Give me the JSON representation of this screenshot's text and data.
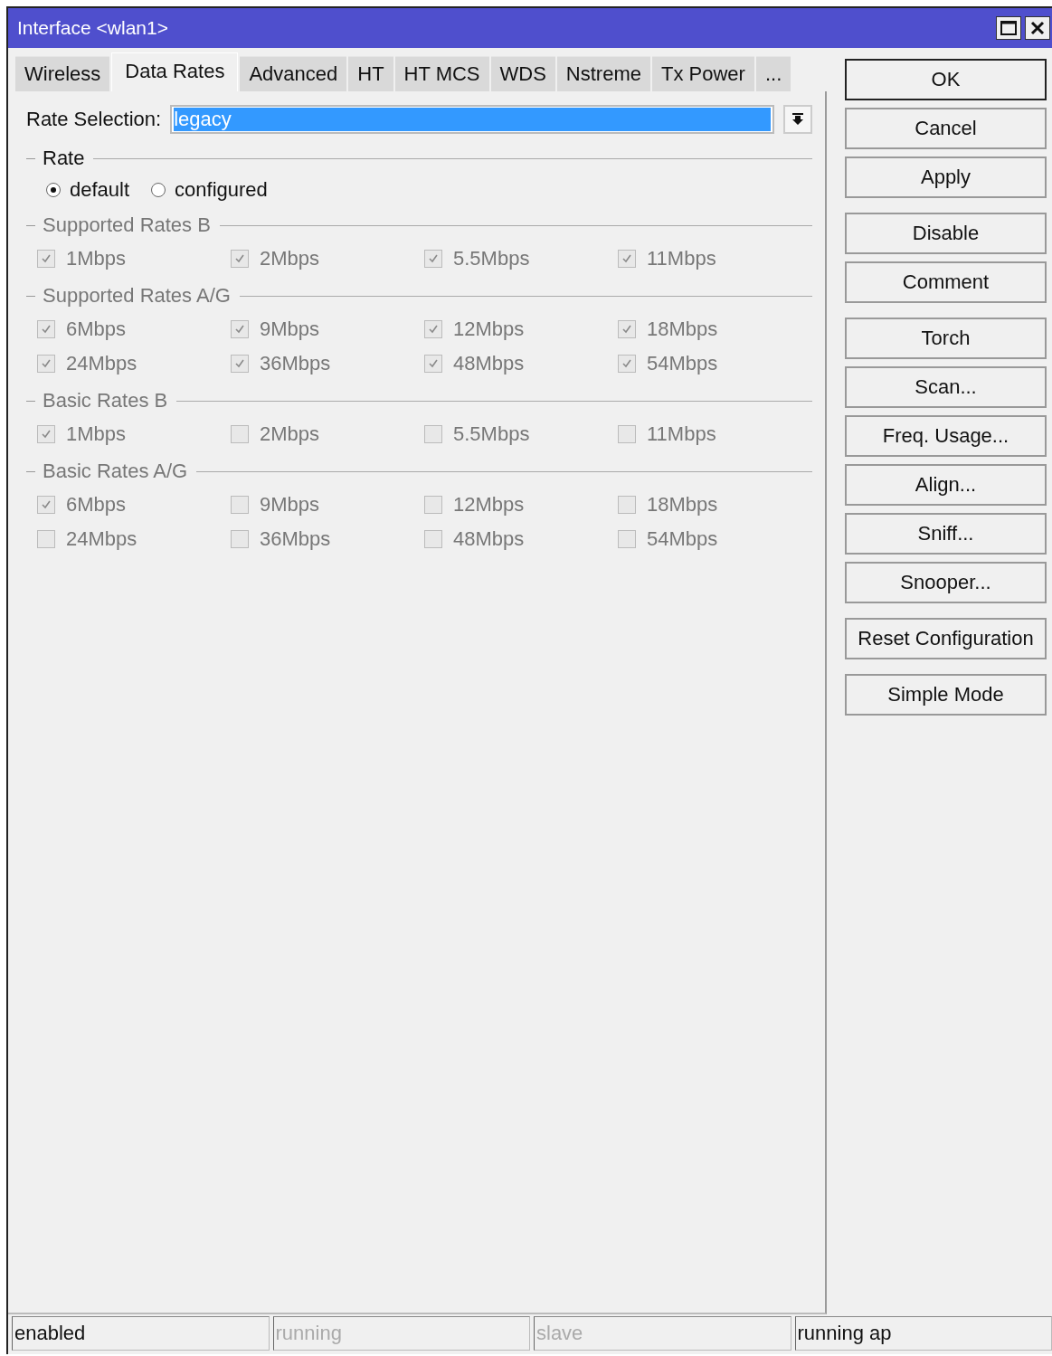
{
  "window": {
    "title": "Interface <wlan1>"
  },
  "tabs": [
    {
      "label": "Wireless",
      "selected": false
    },
    {
      "label": "Data Rates",
      "selected": true
    },
    {
      "label": "Advanced",
      "selected": false
    },
    {
      "label": "HT",
      "selected": false
    },
    {
      "label": "HT MCS",
      "selected": false
    },
    {
      "label": "WDS",
      "selected": false
    },
    {
      "label": "Nstreme",
      "selected": false
    },
    {
      "label": "Tx Power",
      "selected": false
    },
    {
      "label": "...",
      "selected": false
    }
  ],
  "rate_selection": {
    "label": "Rate Selection:",
    "value": "legacy",
    "selected": true
  },
  "rate": {
    "title": "Rate",
    "options": [
      {
        "label": "default",
        "selected": true
      },
      {
        "label": "configured",
        "selected": false
      }
    ]
  },
  "groups": [
    {
      "title": "Supported Rates B",
      "items": [
        {
          "label": "1Mbps",
          "checked": true,
          "disabled": true
        },
        {
          "label": "2Mbps",
          "checked": true,
          "disabled": true
        },
        {
          "label": "5.5Mbps",
          "checked": true,
          "disabled": true
        },
        {
          "label": "11Mbps",
          "checked": true,
          "disabled": true
        }
      ]
    },
    {
      "title": "Supported Rates A/G",
      "items": [
        {
          "label": "6Mbps",
          "checked": true,
          "disabled": true
        },
        {
          "label": "9Mbps",
          "checked": true,
          "disabled": true
        },
        {
          "label": "12Mbps",
          "checked": true,
          "disabled": true
        },
        {
          "label": "18Mbps",
          "checked": true,
          "disabled": true
        },
        {
          "label": "24Mbps",
          "checked": true,
          "disabled": true
        },
        {
          "label": "36Mbps",
          "checked": true,
          "disabled": true
        },
        {
          "label": "48Mbps",
          "checked": true,
          "disabled": true
        },
        {
          "label": "54Mbps",
          "checked": true,
          "disabled": true
        }
      ]
    },
    {
      "title": "Basic Rates B",
      "items": [
        {
          "label": "1Mbps",
          "checked": true,
          "disabled": true
        },
        {
          "label": "2Mbps",
          "checked": false,
          "disabled": true
        },
        {
          "label": "5.5Mbps",
          "checked": false,
          "disabled": true
        },
        {
          "label": "11Mbps",
          "checked": false,
          "disabled": true
        }
      ]
    },
    {
      "title": "Basic Rates A/G",
      "items": [
        {
          "label": "6Mbps",
          "checked": true,
          "disabled": true
        },
        {
          "label": "9Mbps",
          "checked": false,
          "disabled": true
        },
        {
          "label": "12Mbps",
          "checked": false,
          "disabled": true
        },
        {
          "label": "18Mbps",
          "checked": false,
          "disabled": true
        },
        {
          "label": "24Mbps",
          "checked": false,
          "disabled": true
        },
        {
          "label": "36Mbps",
          "checked": false,
          "disabled": true
        },
        {
          "label": "48Mbps",
          "checked": false,
          "disabled": true
        },
        {
          "label": "54Mbps",
          "checked": false,
          "disabled": true
        }
      ]
    }
  ],
  "button_groups": [
    [
      {
        "label": "OK",
        "default": true
      },
      {
        "label": "Cancel",
        "default": false
      },
      {
        "label": "Apply",
        "default": false
      }
    ],
    [
      {
        "label": "Disable",
        "default": false
      },
      {
        "label": "Comment",
        "default": false
      }
    ],
    [
      {
        "label": "Torch",
        "default": false
      },
      {
        "label": "Scan...",
        "default": false
      },
      {
        "label": "Freq. Usage...",
        "default": false
      },
      {
        "label": "Align...",
        "default": false
      },
      {
        "label": "Sniff...",
        "default": false
      },
      {
        "label": "Snooper...",
        "default": false
      }
    ],
    [
      {
        "label": "Reset Configuration",
        "default": false
      }
    ],
    [
      {
        "label": "Simple Mode",
        "default": false
      }
    ]
  ],
  "status_bar": [
    {
      "text": "enabled",
      "disabled": false
    },
    {
      "text": "running",
      "disabled": true
    },
    {
      "text": "slave",
      "disabled": true
    },
    {
      "text": "running ap",
      "disabled": false
    }
  ]
}
